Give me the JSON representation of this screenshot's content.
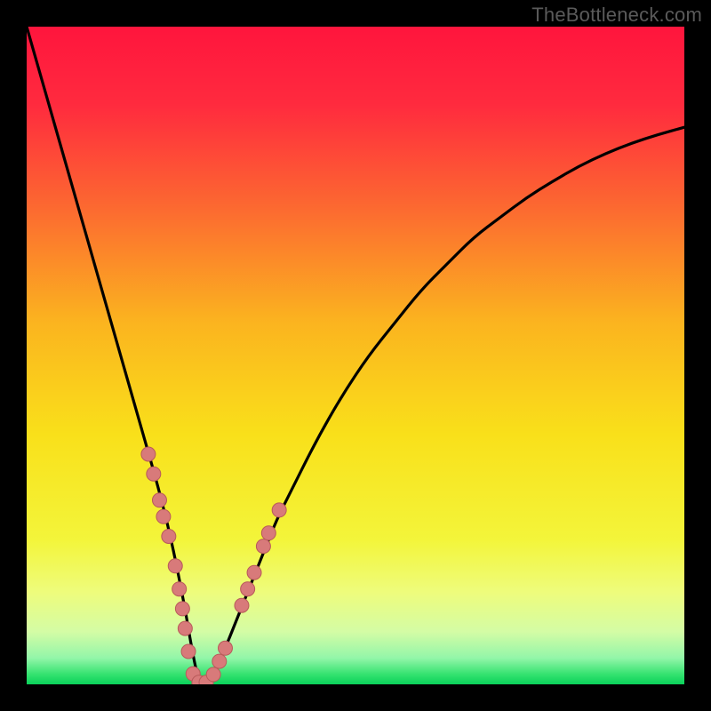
{
  "watermark": "TheBottleneck.com",
  "chart_data": {
    "type": "line",
    "title": "",
    "xlabel": "",
    "ylabel": "",
    "xlim": [
      0,
      100
    ],
    "ylim": [
      0,
      100
    ],
    "grid": false,
    "legend": false,
    "gradient_stops": [
      {
        "offset": 0.0,
        "color": "#ff153d"
      },
      {
        "offset": 0.12,
        "color": "#ff2b3e"
      },
      {
        "offset": 0.28,
        "color": "#fc6b30"
      },
      {
        "offset": 0.45,
        "color": "#fbb41f"
      },
      {
        "offset": 0.62,
        "color": "#f9e01a"
      },
      {
        "offset": 0.78,
        "color": "#f3f53a"
      },
      {
        "offset": 0.86,
        "color": "#eefc7c"
      },
      {
        "offset": 0.92,
        "color": "#d4fca5"
      },
      {
        "offset": 0.96,
        "color": "#93f6a9"
      },
      {
        "offset": 0.985,
        "color": "#34e26f"
      },
      {
        "offset": 1.0,
        "color": "#0ad15a"
      }
    ],
    "series": [
      {
        "name": "bottleneck-curve",
        "stroke": "#000000",
        "stroke_width": 3.2,
        "x": [
          0,
          2,
          4,
          6,
          8,
          10,
          12,
          14,
          16,
          18,
          20,
          22,
          24,
          25,
          26,
          27,
          28,
          30,
          32,
          34,
          36,
          38,
          40,
          44,
          48,
          52,
          56,
          60,
          64,
          68,
          72,
          76,
          80,
          84,
          88,
          92,
          96,
          100
        ],
        "y": [
          100,
          93,
          86,
          79,
          72,
          65,
          58,
          51,
          44,
          37,
          30,
          22,
          12,
          6,
          1,
          0,
          1,
          5,
          10,
          15,
          20,
          25,
          29,
          37,
          44,
          50,
          55,
          60,
          64,
          68,
          71,
          74,
          76.5,
          78.8,
          80.7,
          82.3,
          83.6,
          84.7
        ]
      }
    ],
    "markers": {
      "name": "dots",
      "fill": "#d87a7a",
      "stroke": "#b85a5a",
      "radius": 8,
      "points": [
        {
          "x": 18.5,
          "y": 35
        },
        {
          "x": 19.3,
          "y": 32
        },
        {
          "x": 20.2,
          "y": 28
        },
        {
          "x": 20.8,
          "y": 25.5
        },
        {
          "x": 21.6,
          "y": 22.5
        },
        {
          "x": 22.6,
          "y": 18
        },
        {
          "x": 23.2,
          "y": 14.5
        },
        {
          "x": 23.7,
          "y": 11.5
        },
        {
          "x": 24.1,
          "y": 8.5
        },
        {
          "x": 24.6,
          "y": 5
        },
        {
          "x": 25.3,
          "y": 1.6
        },
        {
          "x": 26.2,
          "y": 0.3
        },
        {
          "x": 27.3,
          "y": 0.3
        },
        {
          "x": 28.4,
          "y": 1.5
        },
        {
          "x": 29.3,
          "y": 3.5
        },
        {
          "x": 30.2,
          "y": 5.5
        },
        {
          "x": 32.7,
          "y": 12
        },
        {
          "x": 33.6,
          "y": 14.5
        },
        {
          "x": 34.6,
          "y": 17
        },
        {
          "x": 36.0,
          "y": 21
        },
        {
          "x": 36.8,
          "y": 23
        },
        {
          "x": 38.4,
          "y": 26.5
        }
      ]
    }
  }
}
